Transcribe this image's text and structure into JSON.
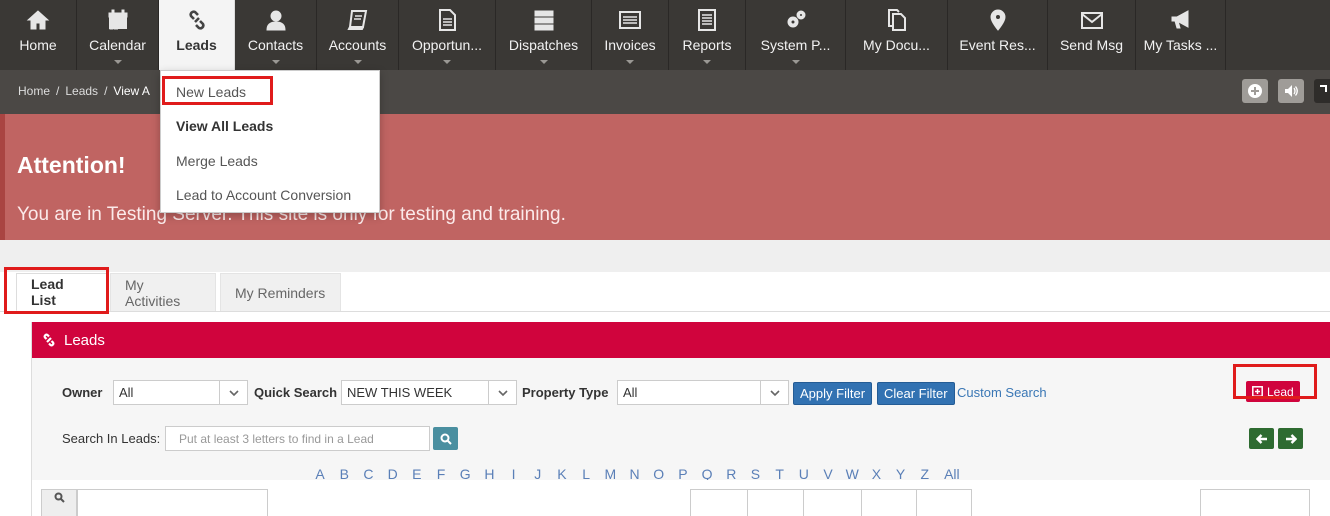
{
  "nav": {
    "items": [
      {
        "label": "Home",
        "icon": "home-icon",
        "caret": false
      },
      {
        "label": "Calendar",
        "icon": "calendar-icon",
        "caret": true
      },
      {
        "label": "Leads",
        "icon": "link-icon",
        "caret": false,
        "active": true
      },
      {
        "label": "Contacts",
        "icon": "user-icon",
        "caret": true
      },
      {
        "label": "Accounts",
        "icon": "book-icon",
        "caret": true
      },
      {
        "label": "Opportun...",
        "icon": "document-icon",
        "caret": true
      },
      {
        "label": "Dispatches",
        "icon": "server-icon",
        "caret": true
      },
      {
        "label": "Invoices",
        "icon": "list-icon",
        "caret": true
      },
      {
        "label": "Reports",
        "icon": "report-icon",
        "caret": true
      },
      {
        "label": "System P...",
        "icon": "gears-icon",
        "caret": true
      },
      {
        "label": "My Docu...",
        "icon": "copy-icon",
        "caret": false
      },
      {
        "label": "Event Res...",
        "icon": "map-marker-icon",
        "caret": false
      },
      {
        "label": "Send Msg",
        "icon": "envelope-icon",
        "caret": false
      },
      {
        "label": "My Tasks ...",
        "icon": "bullhorn-icon",
        "caret": false
      }
    ]
  },
  "breadcrumb": {
    "home": "Home",
    "sep": "/",
    "leads": "Leads",
    "current": "View A"
  },
  "dropdown": {
    "items": [
      "New Leads",
      "View All Leads",
      "Merge Leads",
      "Lead to Account Conversion"
    ]
  },
  "attention": {
    "title": "Attention!",
    "message": "You are in Testing Server. This site is only for testing and training."
  },
  "tabs": [
    "Lead List",
    "My Activities",
    "My Reminders"
  ],
  "panel": {
    "title": "Leads",
    "owner_label": "Owner",
    "owner_value": "All",
    "quick_search_label": "Quick Search",
    "quick_search_value": "NEW THIS WEEK",
    "property_type_label": "Property Type",
    "property_type_value": "All",
    "apply_filter": "Apply Filter",
    "clear_filter": "Clear Filter",
    "custom_search": "Custom Search",
    "add_lead": "Lead",
    "search_label": "Search In Leads:",
    "search_placeholder": "Put at least 3 letters to find in a Lead",
    "alphabet": [
      "A",
      "B",
      "C",
      "D",
      "E",
      "F",
      "G",
      "H",
      "I",
      "J",
      "K",
      "L",
      "M",
      "N",
      "O",
      "P",
      "Q",
      "R",
      "S",
      "T",
      "U",
      "V",
      "W",
      "X",
      "Y",
      "Z",
      "All"
    ]
  },
  "colors": {
    "nav_bg": "#3a3835",
    "accent": "#d0043d",
    "attention_bg": "#c06462",
    "button_blue": "#3272b2",
    "highlight": "#e01b1b"
  }
}
